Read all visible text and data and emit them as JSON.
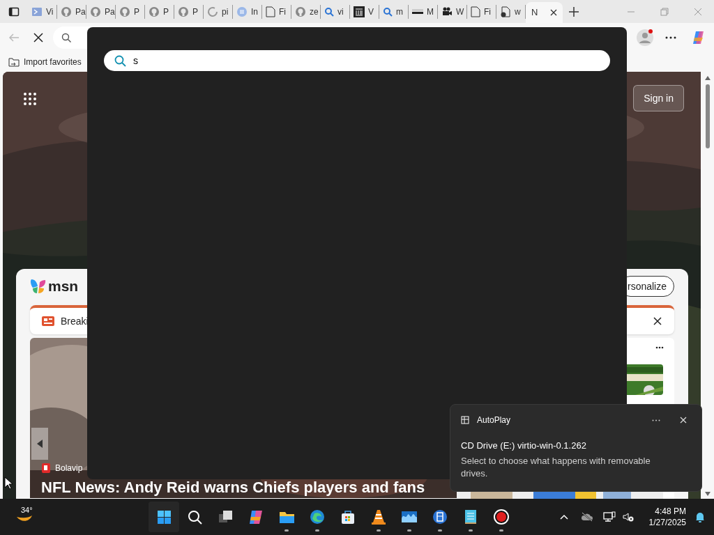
{
  "browser": {
    "tabs": [
      {
        "kind": "terminal",
        "label": "Vi",
        "selected": false
      },
      {
        "kind": "github",
        "label": "Pa",
        "selected": false
      },
      {
        "kind": "github",
        "label": "Pa",
        "selected": false
      },
      {
        "kind": "github",
        "label": "P",
        "selected": false
      },
      {
        "kind": "github",
        "label": "P",
        "selected": false
      },
      {
        "kind": "github",
        "label": "P",
        "selected": false
      },
      {
        "kind": "loading",
        "label": "pi",
        "selected": false
      },
      {
        "kind": "circle",
        "label": "In",
        "selected": false
      },
      {
        "kind": "doc",
        "label": "Fi",
        "selected": false
      },
      {
        "kind": "github",
        "label": "ze",
        "selected": false
      },
      {
        "kind": "search",
        "label": "vi",
        "selected": false
      },
      {
        "kind": "museum",
        "label": "V",
        "selected": false
      },
      {
        "kind": "search",
        "label": "m",
        "selected": false
      },
      {
        "kind": "bar",
        "label": "M",
        "selected": false
      },
      {
        "kind": "camera",
        "label": "W",
        "selected": false
      },
      {
        "kind": "doc",
        "label": "Fi",
        "selected": false
      },
      {
        "kind": "docx",
        "label": "w",
        "selected": false
      },
      {
        "kind": "none",
        "label": "N",
        "selected": true
      }
    ],
    "favorites": [
      "Import favorites"
    ]
  },
  "page": {
    "sign_in": "Sign in",
    "msn": {
      "logo": "msn",
      "personalize": "rsonalize",
      "breaking": "Breaki",
      "feature": {
        "source": "Bolavip",
        "headline": "NFL News: Andy Reid warns Chiefs players and fans"
      }
    }
  },
  "search_overlay": {
    "query": "s"
  },
  "notification": {
    "app": "AutoPlay",
    "title": "CD Drive (E:) virtio-win-0.1.262",
    "body": "Select to choose what happens with removable drives."
  },
  "taskbar": {
    "weather": "34°",
    "apps": [
      {
        "kind": "start",
        "running": false
      },
      {
        "kind": "search",
        "running": false
      },
      {
        "kind": "taskview",
        "running": false
      },
      {
        "kind": "copilot",
        "running": false
      },
      {
        "kind": "explorer",
        "running": true
      },
      {
        "kind": "edge",
        "running": true
      },
      {
        "kind": "store",
        "running": false
      },
      {
        "kind": "vlc",
        "running": true
      },
      {
        "kind": "monitor",
        "running": true
      },
      {
        "kind": "disk",
        "running": true
      },
      {
        "kind": "notepad",
        "running": true
      },
      {
        "kind": "record",
        "running": true
      }
    ],
    "time": "4:48 PM",
    "date": "1/27/2025"
  }
}
